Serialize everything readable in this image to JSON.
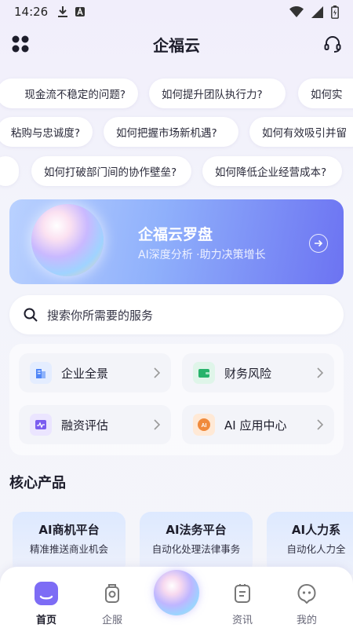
{
  "status_bar": {
    "time": "14:26"
  },
  "header": {
    "title": "企福云"
  },
  "chips": {
    "row1": [
      "现金流不稳定的问题?",
      "如何提升团队执行力?",
      "如何实"
    ],
    "row2": [
      "粘购与忠诚度?",
      "如何把握市场新机遇?",
      "如何有效吸引并留"
    ],
    "row3": [
      "",
      "如何打破部门间的协作壁垒?",
      "如何降低企业经营成本?"
    ]
  },
  "banner": {
    "title": "企福云罗盘",
    "subtitle": "AI深度分析 ·助力决策增长"
  },
  "search": {
    "placeholder": "搜索你所需要的服务"
  },
  "quick_services": [
    {
      "label": "企业全景",
      "icon": "building-icon",
      "color": "#4f86f7"
    },
    {
      "label": "财务风险",
      "icon": "wallet-icon",
      "color": "#27b36b"
    },
    {
      "label": "融资评估",
      "icon": "pulse-icon",
      "color": "#7a5cf0"
    },
    {
      "label": "AI 应用中心",
      "icon": "ai-badge-icon",
      "color": "#f08a3c"
    }
  ],
  "core_products": {
    "title": "核心产品",
    "items": [
      {
        "title": "AI商机平台",
        "subtitle": "精准推送商业机会"
      },
      {
        "title": "AI法务平台",
        "subtitle": "自动化处理法律事务"
      },
      {
        "title": "AI人力系",
        "subtitle": "自动化人力全"
      }
    ]
  },
  "tabbar": {
    "items": [
      {
        "label": "首页",
        "icon": "home-icon",
        "active": true
      },
      {
        "label": "企服",
        "icon": "service-icon",
        "active": false
      },
      {
        "label": "资讯",
        "icon": "news-icon",
        "active": false
      },
      {
        "label": "我的",
        "icon": "profile-icon",
        "active": false
      }
    ]
  }
}
